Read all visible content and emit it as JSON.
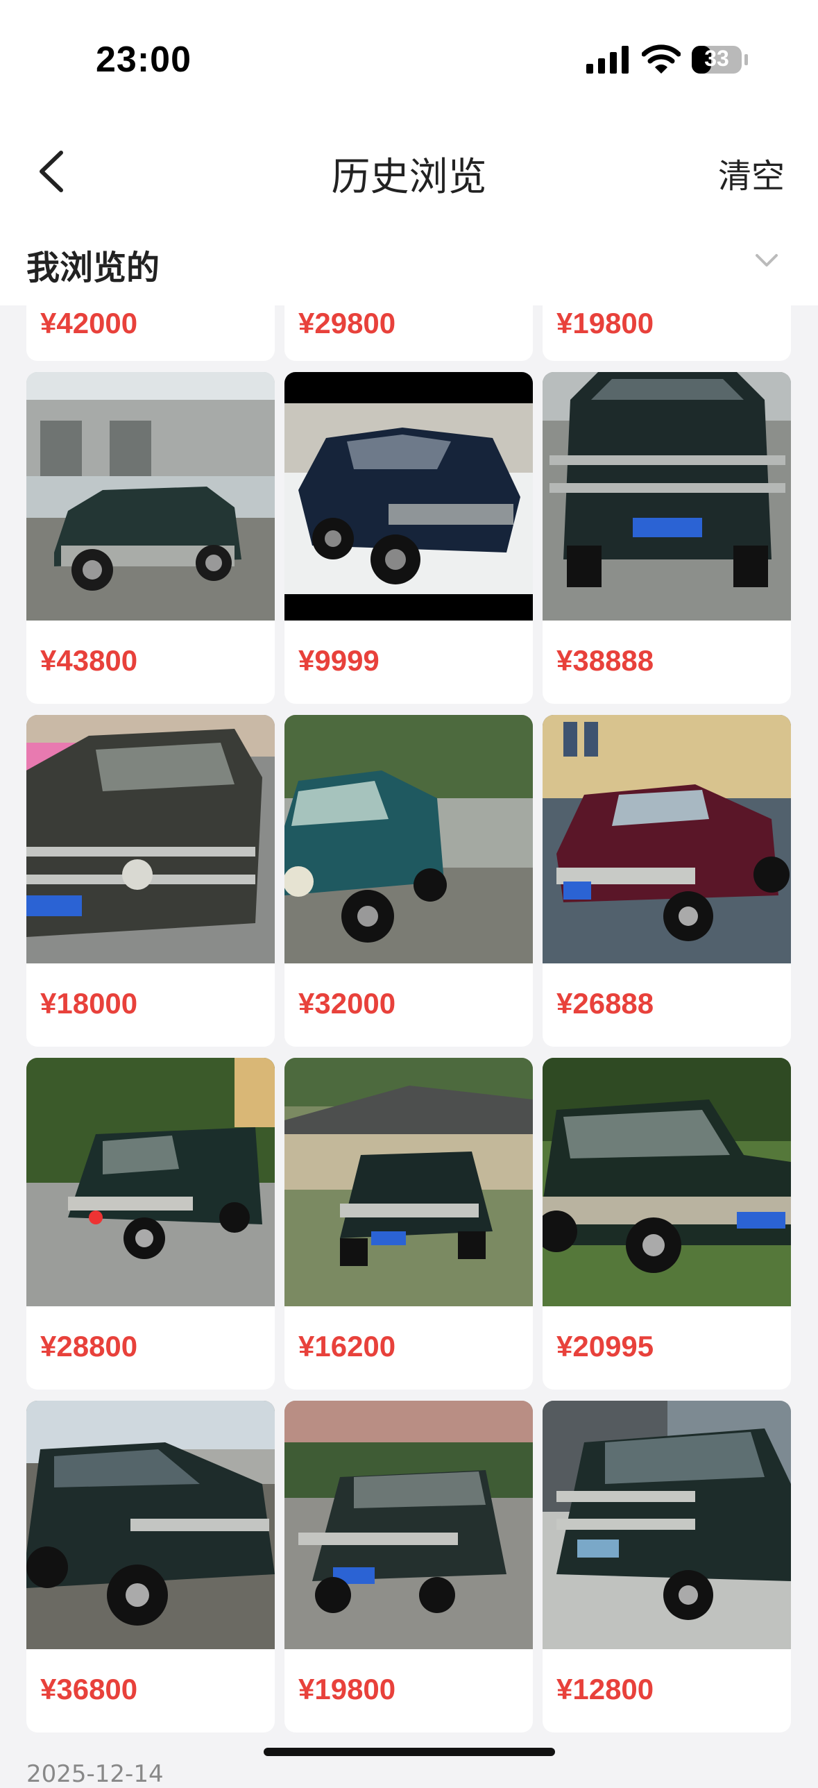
{
  "status_bar": {
    "time": "23:00",
    "battery": "33"
  },
  "nav": {
    "title": "历史浏览",
    "clear_label": "清空"
  },
  "section": {
    "title": "我浏览的"
  },
  "colors": {
    "price": "#e8413b",
    "background": "#f3f3f5",
    "card": "#ffffff"
  },
  "top_row_prices": [
    "¥42000",
    "¥29800",
    "¥19800"
  ],
  "listings": [
    {
      "price": "¥43800",
      "image": "dark-green-suv-in-yard"
    },
    {
      "price": "¥9999",
      "image": "dark-green-suv-cutout"
    },
    {
      "price": "¥38888",
      "image": "green-suv-front-bullbar"
    },
    {
      "price": "¥18000",
      "image": "grey-suv-front-bullbar"
    },
    {
      "price": "¥32000",
      "image": "teal-suv-street"
    },
    {
      "price": "¥26888",
      "image": "maroon-suv-courtyard"
    },
    {
      "price": "¥28800",
      "image": "green-suv-parking-lot"
    },
    {
      "price": "¥16200",
      "image": "green-suv-village"
    },
    {
      "price": "¥20995",
      "image": "green-suv-grass"
    },
    {
      "price": "¥36800",
      "image": "green-suv-gravel"
    },
    {
      "price": "¥19800",
      "image": "grey-suv-plaza"
    },
    {
      "price": "¥12800",
      "image": "green-suv-roadside"
    }
  ],
  "date_peek": "2025-12-14"
}
